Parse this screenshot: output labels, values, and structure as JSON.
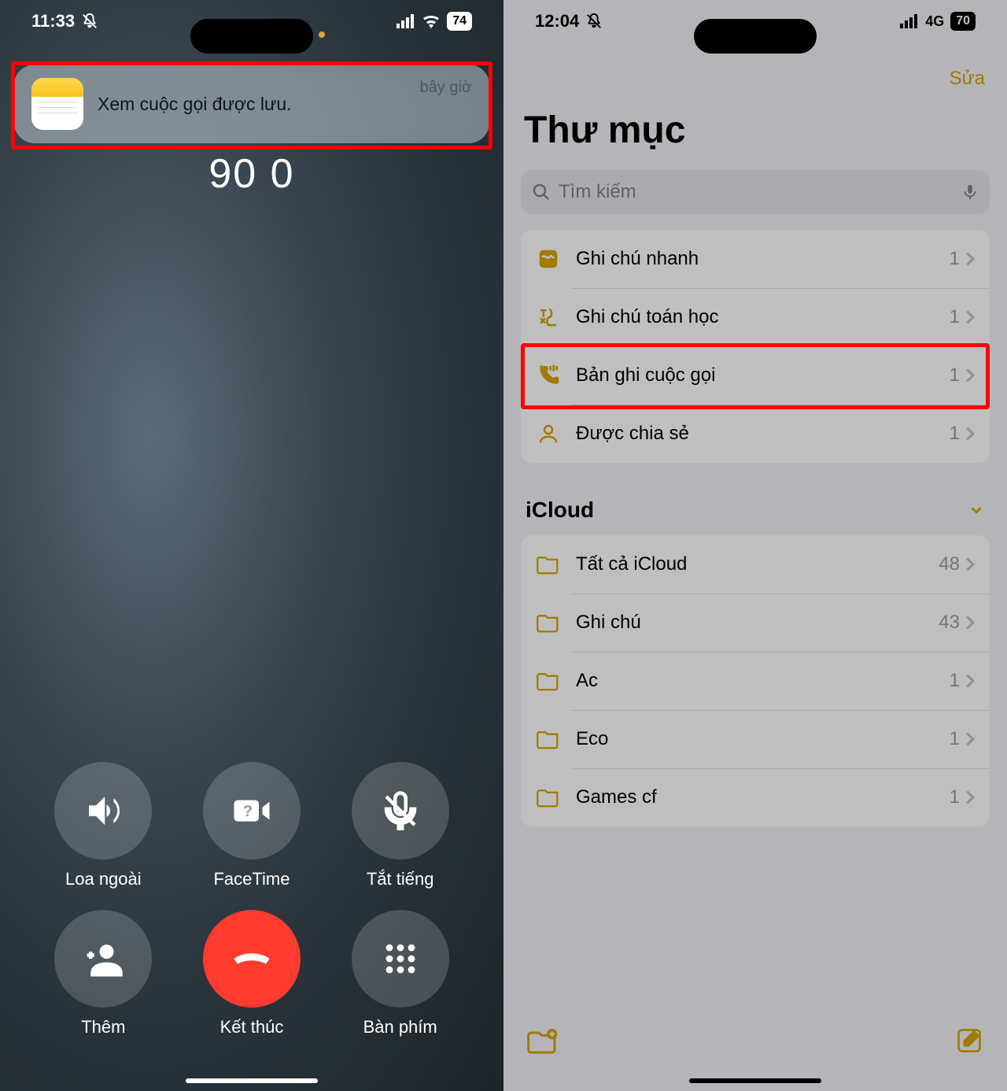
{
  "left": {
    "status": {
      "time": "11:33",
      "battery": "74"
    },
    "notification": {
      "title": "Xem cuộc gọi được lưu.",
      "time": "bây giờ"
    },
    "call_name_line1": "90 0",
    "buttons": {
      "speaker": "Loa ngoài",
      "facetime": "FaceTime",
      "mute": "Tắt tiếng",
      "add": "Thêm",
      "end": "Kết thúc",
      "keypad": "Bàn phím"
    }
  },
  "right": {
    "status": {
      "time": "12:04",
      "network": "4G",
      "battery": "70"
    },
    "edit": "Sửa",
    "title": "Thư mục",
    "search_placeholder": "Tìm kiếm",
    "folders_top": [
      {
        "icon": "quick",
        "name": "Ghi chú nhanh",
        "count": "1"
      },
      {
        "icon": "math",
        "name": "Ghi chú toán học",
        "count": "1"
      },
      {
        "icon": "callrec",
        "name": "Bản ghi cuộc gọi",
        "count": "1"
      },
      {
        "icon": "shared",
        "name": "Được chia sẻ",
        "count": "1"
      }
    ],
    "section": "iCloud",
    "folders_icloud": [
      {
        "icon": "folder",
        "name": "Tất cả iCloud",
        "count": "48"
      },
      {
        "icon": "folder",
        "name": "Ghi chú",
        "count": "43"
      },
      {
        "icon": "folder",
        "name": "Ac",
        "count": "1"
      },
      {
        "icon": "folder",
        "name": "Eco",
        "count": "1"
      },
      {
        "icon": "folder",
        "name": "Games cf",
        "count": "1"
      }
    ]
  }
}
